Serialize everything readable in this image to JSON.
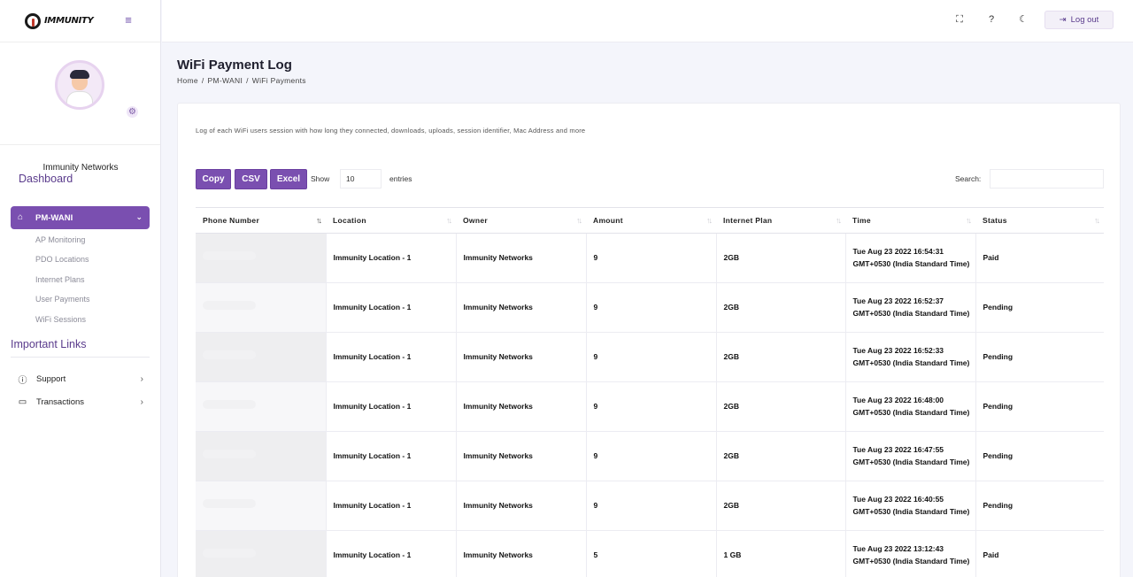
{
  "brand": {
    "logo_text": "IMMUNITY"
  },
  "profile": {
    "name": "Immunity Networks"
  },
  "sidebar": {
    "dashboard_label": "Dashboard",
    "active_section": "PM-WANI",
    "sub_items": [
      {
        "label": "AP Monitoring"
      },
      {
        "label": "PDO Locations"
      },
      {
        "label": "Internet Plans"
      },
      {
        "label": "User Payments"
      },
      {
        "label": "WiFi Sessions"
      }
    ],
    "important_links_label": "Important Links",
    "links": [
      {
        "label": "Support",
        "icon": "help-circle-icon"
      },
      {
        "label": "Transactions",
        "icon": "card-icon"
      }
    ]
  },
  "topbar": {
    "logout_label": "Log out"
  },
  "page": {
    "title": "WiFi Payment Log",
    "breadcrumb": [
      "Home",
      "PM-WANI",
      "WiFi Payments"
    ],
    "description": "Log of each WiFi users session with how long they connected, downloads, uploads, session identifier, Mac Address and more"
  },
  "toolbar": {
    "buttons": [
      "Copy",
      "CSV",
      "Excel"
    ],
    "show_label": "Show",
    "entries_value": "10",
    "entries_label": "entries",
    "search_label": "Search:"
  },
  "table": {
    "columns": [
      "Phone Number",
      "Location",
      "Owner",
      "Amount",
      "Internet Plan",
      "Time",
      "Status"
    ],
    "rows": [
      {
        "location": "Immunity Location - 1",
        "owner": "Immunity Networks",
        "amount": "9",
        "plan": "2GB",
        "time": "Tue Aug 23 2022 16:54:31 GMT+0530 (India Standard Time)",
        "status": "Paid"
      },
      {
        "location": "Immunity Location - 1",
        "owner": "Immunity Networks",
        "amount": "9",
        "plan": "2GB",
        "time": "Tue Aug 23 2022 16:52:37 GMT+0530 (India Standard Time)",
        "status": "Pending"
      },
      {
        "location": "Immunity Location - 1",
        "owner": "Immunity Networks",
        "amount": "9",
        "plan": "2GB",
        "time": "Tue Aug 23 2022 16:52:33 GMT+0530 (India Standard Time)",
        "status": "Pending"
      },
      {
        "location": "Immunity Location - 1",
        "owner": "Immunity Networks",
        "amount": "9",
        "plan": "2GB",
        "time": "Tue Aug 23 2022 16:48:00 GMT+0530 (India Standard Time)",
        "status": "Pending"
      },
      {
        "location": "Immunity Location - 1",
        "owner": "Immunity Networks",
        "amount": "9",
        "plan": "2GB",
        "time": "Tue Aug 23 2022 16:47:55 GMT+0530 (India Standard Time)",
        "status": "Pending"
      },
      {
        "location": "Immunity Location - 1",
        "owner": "Immunity Networks",
        "amount": "9",
        "plan": "2GB",
        "time": "Tue Aug 23 2022 16:40:55 GMT+0530 (India Standard Time)",
        "status": "Pending"
      },
      {
        "location": "Immunity Location - 1",
        "owner": "Immunity Networks",
        "amount": "5",
        "plan": "1 GB",
        "time": "Tue Aug 23 2022 13:12:43 GMT+0530 (India Standard Time)",
        "status": "Paid"
      }
    ]
  },
  "colors": {
    "accent": "#7a4fb0",
    "heading": "#5a3b8c",
    "background": "#f4f5fb"
  }
}
